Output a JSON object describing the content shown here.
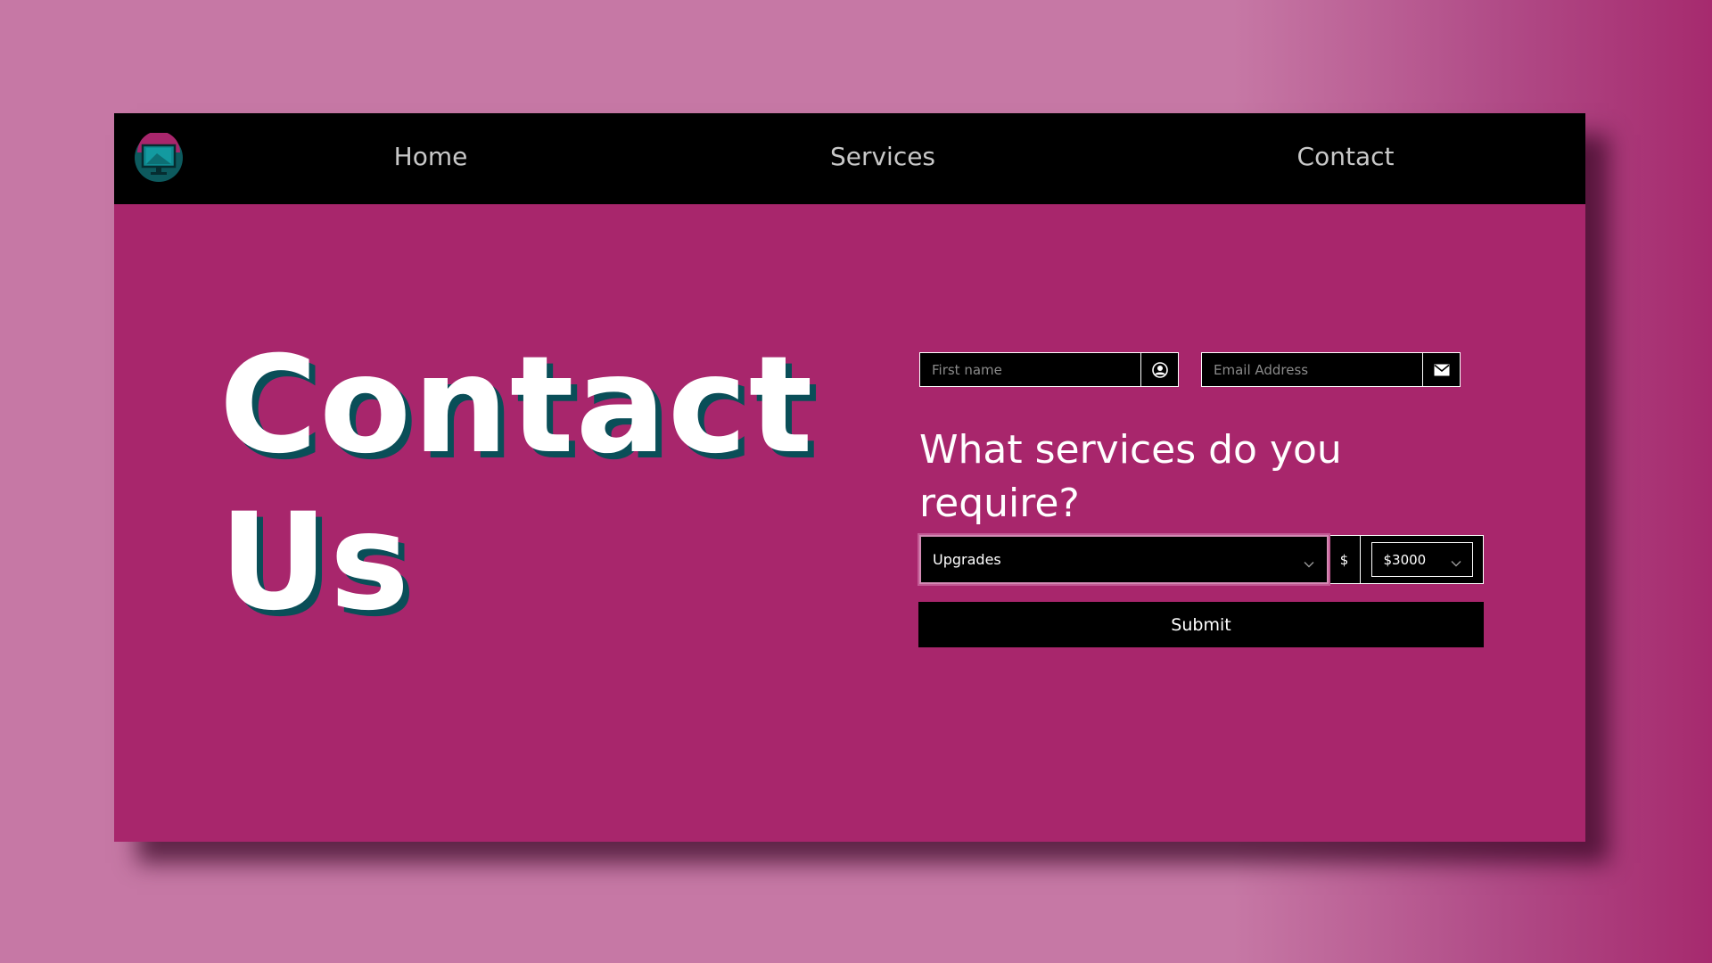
{
  "nav": {
    "logo_icon": "monitor-logo-icon",
    "items": [
      {
        "label": "Home"
      },
      {
        "label": "Services"
      },
      {
        "label": "Contact"
      }
    ]
  },
  "hero": {
    "line1": "Contact",
    "line2": "Us"
  },
  "form": {
    "first_name": {
      "placeholder": "First name",
      "value": "",
      "icon": "user-circle-icon"
    },
    "email": {
      "placeholder": "Email Address",
      "value": "",
      "icon": "envelope-icon"
    },
    "question": "What services do you require?",
    "service_select": {
      "selected": "Upgrades",
      "icon": "chevron-down-icon"
    },
    "currency_symbol": "$",
    "budget_select": {
      "selected": "$3000",
      "icon": "chevron-down-icon"
    },
    "submit_label": "Submit"
  },
  "colors": {
    "background": "#c678a5",
    "panel": "#a8266c",
    "navbar": "#000000",
    "title_shadow": "#0a4e58",
    "text": "#ffffff"
  }
}
